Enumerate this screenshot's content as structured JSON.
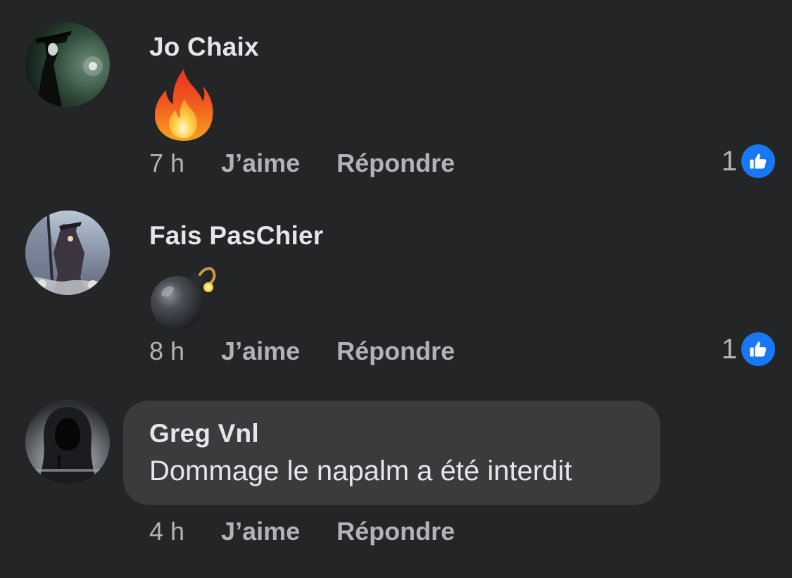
{
  "comments": [
    {
      "author": "Jo Chaix",
      "avatar_icon": "masked-figure-avatar",
      "content_emoji": "fire-emoji",
      "time": "7 h",
      "like_label": "J’aime",
      "reply_label": "Répondre",
      "reaction_count": "1",
      "reaction_icon": "thumbs-up-icon"
    },
    {
      "author": "Fais PasChier",
      "avatar_icon": "fantasy-artwork-avatar",
      "content_emoji": "bomb-emoji",
      "time": "8 h",
      "like_label": "J’aime",
      "reply_label": "Répondre",
      "reaction_count": "1",
      "reaction_icon": "thumbs-up-icon"
    },
    {
      "author": "Greg Vnl",
      "avatar_icon": "hooded-figure-avatar",
      "text": "Dommage le napalm a été interdit",
      "time": "4 h",
      "like_label": "J’aime",
      "reply_label": "Répondre"
    }
  ],
  "colors": {
    "background": "#242526",
    "bubble": "#3a3b3c",
    "primary_text": "#e4e6eb",
    "secondary_text": "#b0b3b8",
    "like_blue": "#1877f2"
  }
}
